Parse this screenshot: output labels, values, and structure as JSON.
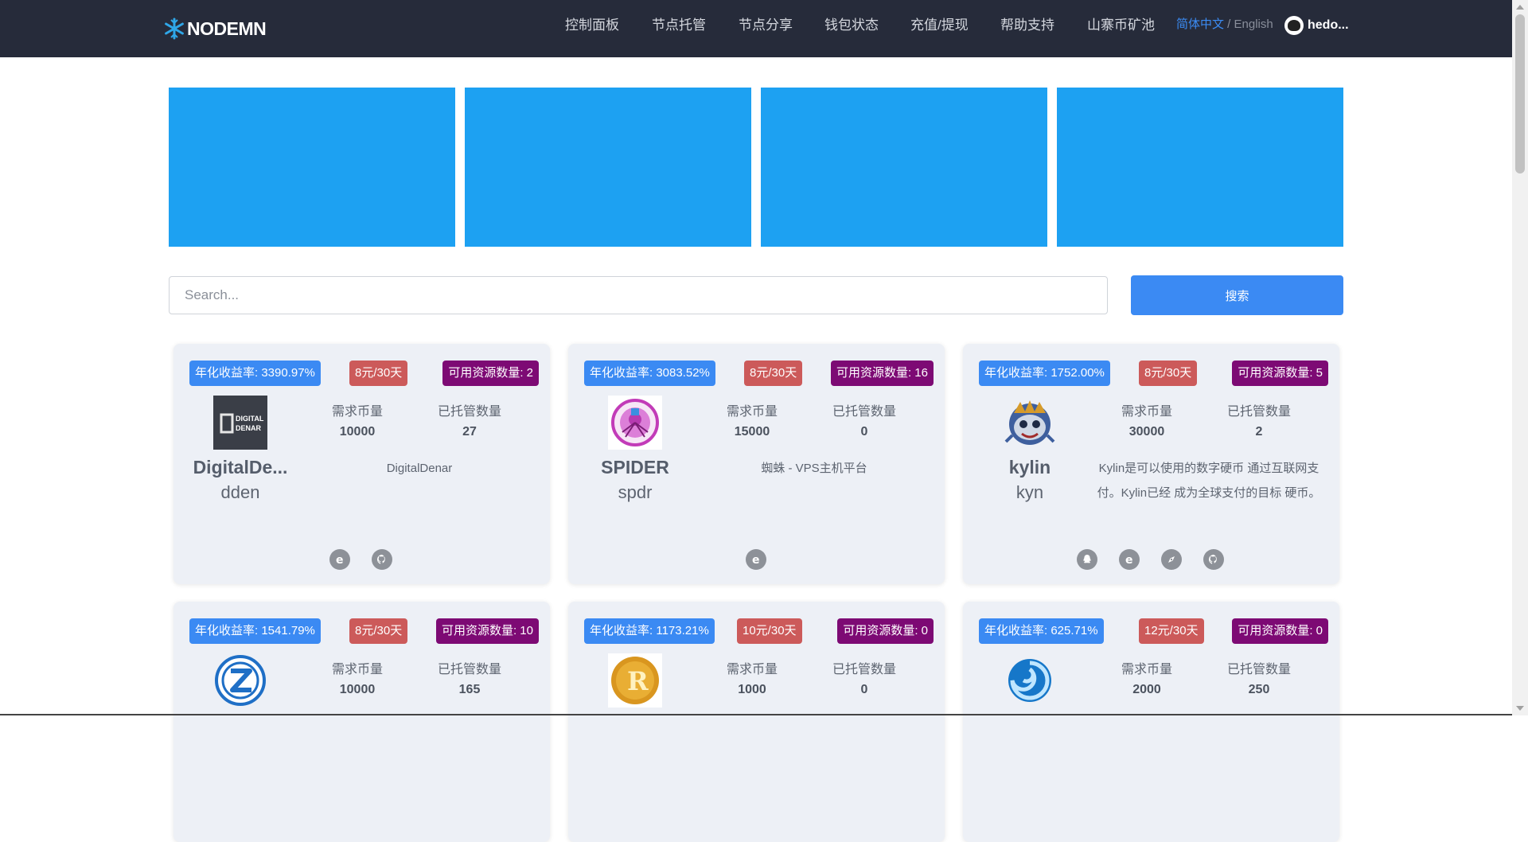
{
  "navbar": {
    "logo_text": "NODEMN",
    "items": [
      "控制面板",
      "节点托管",
      "节点分享",
      "钱包状态",
      "充值/提现",
      "帮助支持",
      "山寨币矿池"
    ],
    "lang_cn": "简体中文",
    "lang_sep": " / ",
    "lang_en": "English",
    "username": "hedo..."
  },
  "search": {
    "placeholder": "Search...",
    "button_label": "搜索"
  },
  "cards": [
    {
      "rate": "年化收益率: 3390.97%",
      "price": "8元/30天",
      "resources": "可用资源数量: 2",
      "label_required": "需求币量",
      "label_hosted": "已托管数量",
      "required": "10000",
      "hosted": "27",
      "name": "DigitalDe...",
      "ticker": "dden",
      "description": "DigitalDenar",
      "logo_text_1": "DIGITAL",
      "logo_text_2": "DENAR",
      "links": [
        "website-icon",
        "github-icon"
      ]
    },
    {
      "rate": "年化收益率: 3083.52%",
      "price": "8元/30天",
      "resources": "可用资源数量: 16",
      "label_required": "需求币量",
      "label_hosted": "已托管数量",
      "required": "15000",
      "hosted": "0",
      "name": "SPIDER",
      "ticker": "spdr",
      "description": "蜘蛛 - VPS主机平台",
      "links": [
        "website-icon"
      ]
    },
    {
      "rate": "年化收益率: 1752.00%",
      "price": "8元/30天",
      "resources": "可用资源数量: 5",
      "label_required": "需求币量",
      "label_hosted": "已托管数量",
      "required": "30000",
      "hosted": "2",
      "name": "kylin",
      "ticker": "kyn",
      "description": "Kylin是可以使用的数字硬币 通过互联网支付。Kylin已经 成为全球支付的目标 硬币。",
      "links": [
        "qq-icon",
        "website-icon",
        "explorer-icon",
        "github-icon"
      ]
    },
    {
      "rate": "年化收益率: 1541.79%",
      "price": "8元/30天",
      "resources": "可用资源数量: 10",
      "label_required": "需求币量",
      "label_hosted": "已托管数量",
      "required": "10000",
      "hosted": "165"
    },
    {
      "rate": "年化收益率: 1173.21%",
      "price": "10元/30天",
      "resources": "可用资源数量: 0",
      "label_required": "需求币量",
      "label_hosted": "已托管数量",
      "required": "1000",
      "hosted": "0"
    },
    {
      "rate": "年化收益率: 625.71%",
      "price": "12元/30天",
      "resources": "可用资源数量: 0",
      "label_required": "需求币量",
      "label_hosted": "已托管数量",
      "required": "2000",
      "hosted": "250"
    }
  ],
  "colors": {
    "navbar_bg": "#262b3a",
    "banner": "#1da1f2",
    "accent_blue": "#3b8af3",
    "price_red": "#cc5a5a",
    "resource_purple": "#7d0a74",
    "card_bg": "#edf0f6"
  }
}
